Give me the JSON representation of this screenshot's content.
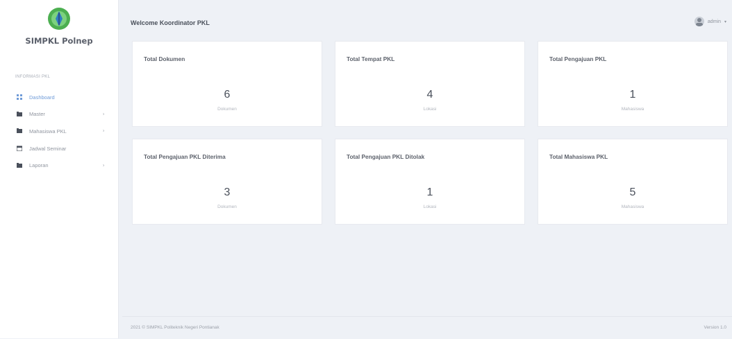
{
  "sidebar": {
    "brand_name": "SIMPKL Polnep",
    "section_label": "Informasi PKL",
    "items": [
      {
        "label": "Dashboard",
        "icon": "dashboard-icon",
        "active": true,
        "has_chevron": false
      },
      {
        "label": "Master",
        "icon": "folder-icon",
        "active": false,
        "has_chevron": true
      },
      {
        "label": "Mahasiswa PKL",
        "icon": "users-icon",
        "active": false,
        "has_chevron": true
      },
      {
        "label": "Jadwal Seminar",
        "icon": "calendar-icon",
        "active": false,
        "has_chevron": false
      },
      {
        "label": "Laporan",
        "icon": "report-icon",
        "active": false,
        "has_chevron": true
      }
    ]
  },
  "header": {
    "welcome": "Welcome Koordinator PKL",
    "user": "admin"
  },
  "cards": [
    {
      "title": "Total Dokumen",
      "value": "6",
      "unit": "Dokumen"
    },
    {
      "title": "Total Tempat PKL",
      "value": "4",
      "unit": "Lokasi"
    },
    {
      "title": "Total Pengajuan PKL",
      "value": "1",
      "unit": "Mahasiswa"
    },
    {
      "title": "Total Pengajuan PKL Diterima",
      "value": "3",
      "unit": "Dokumen"
    },
    {
      "title": "Total Pengajuan PKL Ditolak",
      "value": "1",
      "unit": "Lokasi"
    },
    {
      "title": "Total Mahasiswa PKL",
      "value": "5",
      "unit": "Mahasiswa"
    }
  ],
  "footer": {
    "copyright": "2021 © SIMPKL Politeknik Negeri Pontianak",
    "version": "Version 1.0"
  },
  "colors": {
    "accent": "#6f9bd8",
    "logo_green": "#4caf50",
    "background": "#eef1f6"
  }
}
